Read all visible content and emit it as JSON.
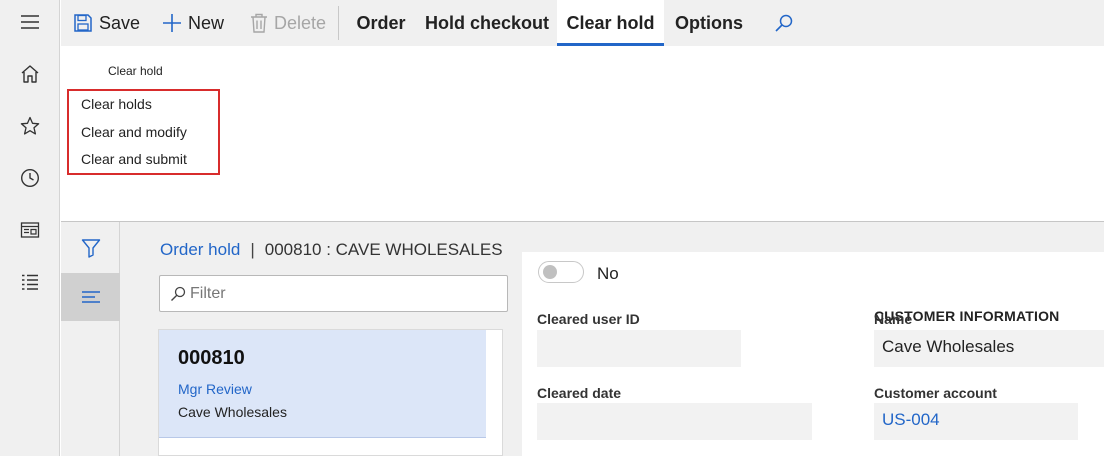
{
  "toolbar": {
    "save_label": "Save",
    "new_label": "New",
    "delete_label": "Delete",
    "tabs": [
      {
        "label": "Order"
      },
      {
        "label": "Hold checkout"
      },
      {
        "label": "Clear hold"
      },
      {
        "label": "Options"
      }
    ]
  },
  "ribbon": {
    "group_title": "Clear hold",
    "items": [
      {
        "label": "Clear holds"
      },
      {
        "label": "Clear and modify"
      },
      {
        "label": "Clear and submit"
      }
    ]
  },
  "breadcrumb": {
    "link": "Order hold",
    "separator": "|",
    "title": "000810 : CAVE WHOLESALES"
  },
  "filter": {
    "placeholder": "Filter"
  },
  "list": {
    "items": [
      {
        "id": "000810",
        "status": "Mgr Review",
        "customer": "Cave Wholesales"
      }
    ]
  },
  "details": {
    "toggle_text": "No",
    "cleared_user_label": "Cleared user ID",
    "cleared_user_value": "",
    "cleared_date_label": "Cleared date",
    "cleared_date_value": "",
    "customer_section_title": "CUSTOMER INFORMATION",
    "name_label": "Name",
    "name_value": "Cave Wholesales",
    "account_label": "Customer account",
    "account_value": "US-004"
  },
  "colors": {
    "accent": "#2266c8",
    "highlight_border": "#d82c2c",
    "selected_card": "#dce6f8"
  }
}
